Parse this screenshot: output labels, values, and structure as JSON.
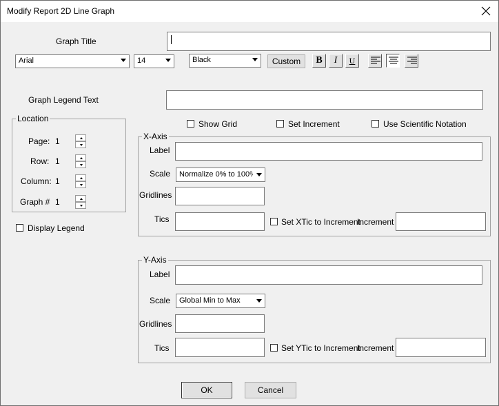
{
  "window": {
    "title": "Modify Report 2D Line Graph"
  },
  "graph_title": {
    "label": "Graph Title",
    "value": ""
  },
  "font": {
    "family": "Arial",
    "size": "14",
    "color": "Black",
    "custom_label": "Custom"
  },
  "format": {
    "bold": "B",
    "italic": "I",
    "underline": "U",
    "alignment": "center"
  },
  "legend_text": {
    "label": "Graph Legend Text",
    "value": ""
  },
  "options": {
    "show_grid": "Show Grid",
    "set_increment": "Set Increment",
    "use_scientific_notation": "Use Scientific Notation"
  },
  "location": {
    "title": "Location",
    "page": {
      "label": "Page:",
      "value": "1"
    },
    "row": {
      "label": "Row:",
      "value": "1"
    },
    "column": {
      "label": "Column:",
      "value": "1"
    },
    "graph": {
      "label": "Graph #",
      "value": "1"
    }
  },
  "display_legend": "Display Legend",
  "x_axis": {
    "title": "X-Axis",
    "label_label": "Label",
    "scale_label": "Scale",
    "scale_value": "Normalize 0% to 100%",
    "gridlines_label": "Gridlines",
    "tics_label": "Tics",
    "set_tic_label": "Set XTic to Increment",
    "increment_label": "Increment"
  },
  "y_axis": {
    "title": "Y-Axis",
    "label_label": "Label",
    "scale_label": "Scale",
    "scale_value": "Global Min to Max",
    "gridlines_label": "Gridlines",
    "tics_label": "Tics",
    "set_tic_label": "Set YTic to Increment",
    "increment_label": "Increment"
  },
  "buttons": {
    "ok": "OK",
    "cancel": "Cancel"
  }
}
